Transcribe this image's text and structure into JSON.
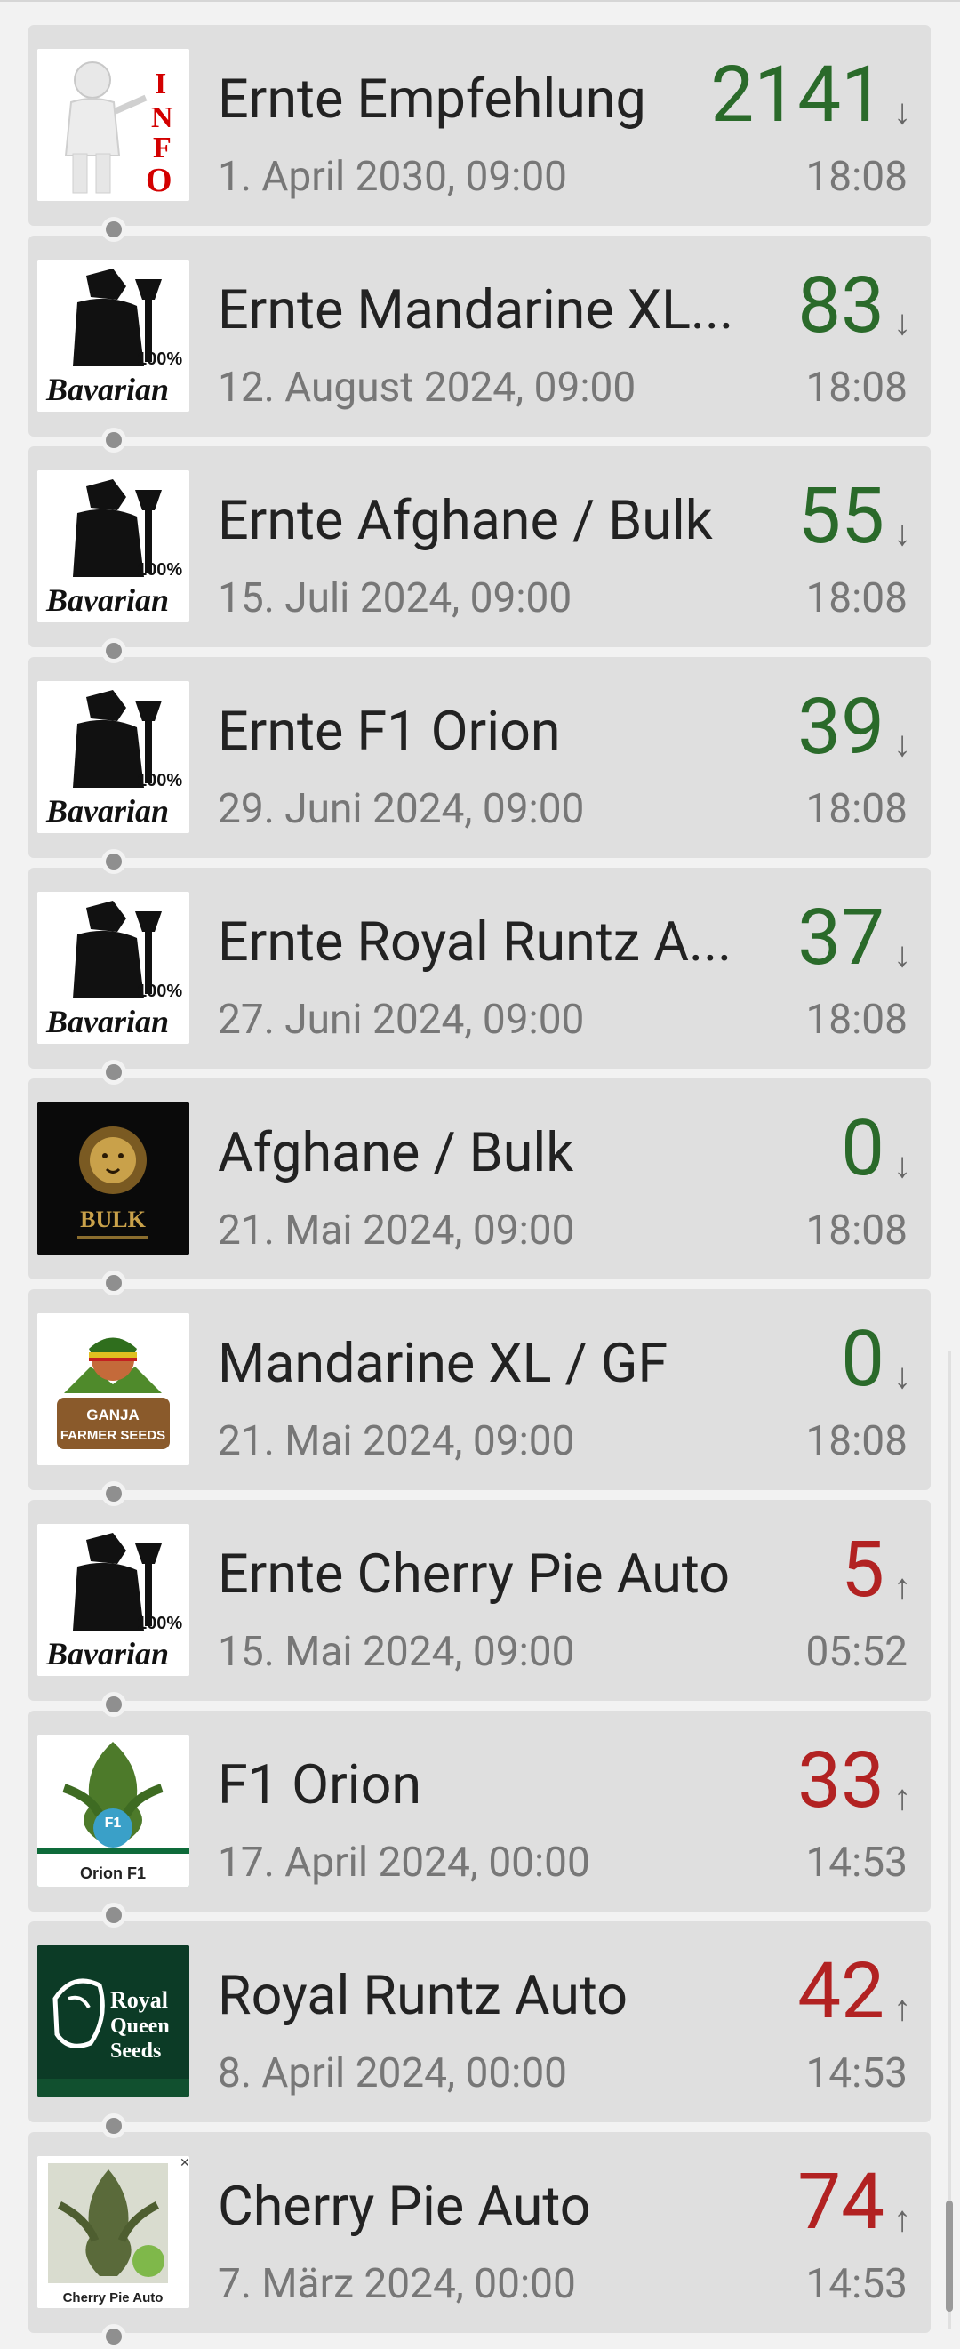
{
  "items": [
    {
      "title": "Ernte Empfehlung",
      "date": "1. April 2030, 09:00",
      "count": "2141",
      "trend": "down",
      "time": "18:08",
      "icon": "info-figure-icon"
    },
    {
      "title": "Ernte Mandarine XL...",
      "date": "12. August 2024, 09:00",
      "count": "83",
      "trend": "down",
      "time": "18:08",
      "icon": "bavarian-logo-icon",
      "logo_text": "Bavarian",
      "logo_badge": "100%"
    },
    {
      "title": "Ernte Afghane / Bulk",
      "date": "15. Juli 2024, 09:00",
      "count": "55",
      "trend": "down",
      "time": "18:08",
      "icon": "bavarian-logo-icon",
      "logo_text": "Bavarian",
      "logo_badge": "100%"
    },
    {
      "title": "Ernte F1 Orion",
      "date": "29. Juni 2024, 09:00",
      "count": "39",
      "trend": "down",
      "time": "18:08",
      "icon": "bavarian-logo-icon",
      "logo_text": "Bavarian",
      "logo_badge": "100%"
    },
    {
      "title": "Ernte Royal Runtz A...",
      "date": "27. Juni 2024, 09:00",
      "count": "37",
      "trend": "down",
      "time": "18:08",
      "icon": "bavarian-logo-icon",
      "logo_text": "Bavarian",
      "logo_badge": "100%"
    },
    {
      "title": "Afghane / Bulk",
      "date": "21. Mai 2024, 09:00",
      "count": "0",
      "trend": "down",
      "time": "18:08",
      "icon": "bulk-lion-logo-icon",
      "logo_text": "BULK"
    },
    {
      "title": "Mandarine XL / GF",
      "date": "21. Mai 2024, 09:00",
      "count": "0",
      "trend": "down",
      "time": "18:08",
      "icon": "ganja-farmer-logo-icon",
      "logo_text": "GANJA FARMER SEEDS"
    },
    {
      "title": "Ernte Cherry Pie Auto",
      "date": "15. Mai 2024, 09:00",
      "count": "5",
      "trend": "up",
      "time": "05:52",
      "icon": "bavarian-logo-icon",
      "logo_text": "Bavarian",
      "logo_badge": "100%"
    },
    {
      "title": "F1 Orion",
      "date": "17. April 2024, 00:00",
      "count": "33",
      "trend": "up",
      "time": "14:53",
      "icon": "orion-plant-icon",
      "logo_text": "Orion F1",
      "logo_badge": "F1"
    },
    {
      "title": "Royal Runtz Auto",
      "date": "8. April 2024, 00:00",
      "count": "42",
      "trend": "up",
      "time": "14:53",
      "icon": "royal-queen-seeds-logo-icon",
      "logo_text": "Royal Queen Seeds"
    },
    {
      "title": "Cherry Pie Auto",
      "date": "7. März 2024, 00:00",
      "count": "74",
      "trend": "up",
      "time": "14:53",
      "icon": "cherry-pie-plant-icon",
      "logo_text": "Cherry Pie Auto"
    }
  ],
  "arrows": {
    "down": "↓",
    "up": "↑"
  },
  "colors": {
    "down": "#2a6a2a",
    "up": "#b22222",
    "card": "#dfdfdf",
    "background": "#f2f2f2"
  }
}
